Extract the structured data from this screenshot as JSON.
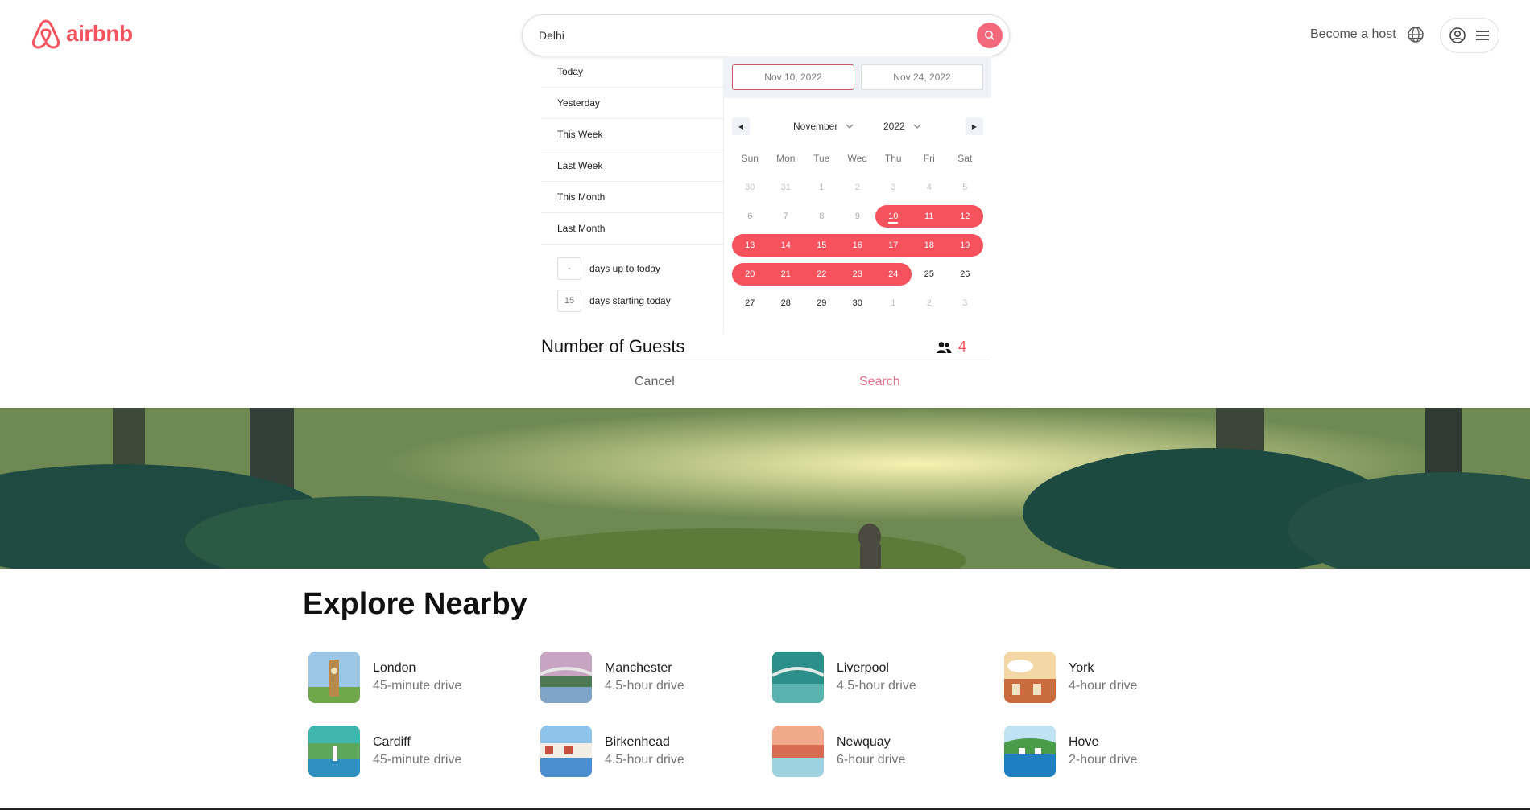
{
  "header": {
    "brand": "airbnb",
    "search_value": "Delhi",
    "become_host": "Become a host"
  },
  "date_picker": {
    "ranges": [
      "Today",
      "Yesterday",
      "This Week",
      "Last Week",
      "This Month",
      "Last Month"
    ],
    "days_up_to_today": {
      "value": "-",
      "label": "days up to today"
    },
    "days_starting_today": {
      "value": "15",
      "label": "days starting today"
    },
    "start_date": "Nov 10, 2022",
    "end_date": "Nov 24, 2022",
    "month": "November",
    "year": "2022",
    "weekdays": [
      "Sun",
      "Mon",
      "Tue",
      "Wed",
      "Thu",
      "Fri",
      "Sat"
    ],
    "weeks": [
      [
        "30",
        "31",
        "1",
        "2",
        "3",
        "4",
        "5"
      ],
      [
        "6",
        "7",
        "8",
        "9",
        "10",
        "11",
        "12"
      ],
      [
        "13",
        "14",
        "15",
        "16",
        "17",
        "18",
        "19"
      ],
      [
        "20",
        "21",
        "22",
        "23",
        "24",
        "25",
        "26"
      ],
      [
        "27",
        "28",
        "29",
        "30",
        "1",
        "2",
        "3"
      ]
    ],
    "accent_color": "#f5525e"
  },
  "guests": {
    "title": "Number of Guests",
    "count": "4"
  },
  "actions": {
    "cancel": "Cancel",
    "search": "Search"
  },
  "explore": {
    "title": "Explore Nearby",
    "places": [
      {
        "name": "London",
        "distance": "45-minute drive"
      },
      {
        "name": "Manchester",
        "distance": "4.5-hour drive"
      },
      {
        "name": "Liverpool",
        "distance": "4.5-hour drive"
      },
      {
        "name": "York",
        "distance": "4-hour drive"
      },
      {
        "name": "Cardiff",
        "distance": "45-minute drive"
      },
      {
        "name": "Birkenhead",
        "distance": "4.5-hour drive"
      },
      {
        "name": "Newquay",
        "distance": "6-hour drive"
      },
      {
        "name": "Hove",
        "distance": "2-hour drive"
      }
    ]
  }
}
